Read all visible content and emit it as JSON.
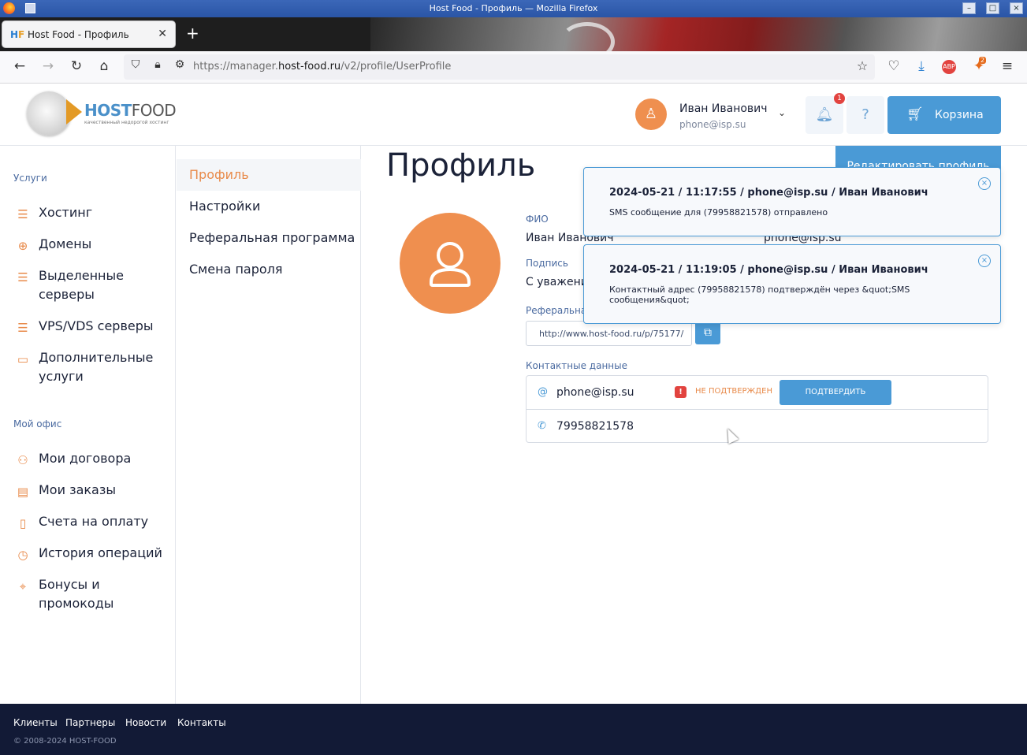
{
  "window": {
    "title": "Host Food - Профиль — Mozilla Firefox"
  },
  "browser": {
    "tab_title": "Host Food - Профиль",
    "url_prefix": "https://manager.",
    "url_domain": "host-food.ru",
    "url_path": "/v2/profile/UserProfile",
    "extension_badge": "2",
    "abp_label": "ABP"
  },
  "header": {
    "logo_host": "HOST",
    "logo_food": "FOOD",
    "logo_tagline": "качественный недорогой хостинг",
    "user_name": "Иван Иванович",
    "user_email": "phone@isp.su",
    "notifications_count": "1",
    "cart_label": "Корзина"
  },
  "sidebar": {
    "services_title": "Услуги",
    "services": [
      {
        "label": "Хостинг",
        "icon": "stack-icon"
      },
      {
        "label": "Домены",
        "icon": "globe-icon"
      },
      {
        "label": "Выделенные серверы",
        "icon": "server-icon"
      },
      {
        "label": "VPS/VDS серверы",
        "icon": "vps-icon"
      },
      {
        "label": "Дополнительные услуги",
        "icon": "window-icon"
      }
    ],
    "office_title": "Мой офис",
    "office": [
      {
        "label": "Мои договора",
        "icon": "users-icon"
      },
      {
        "label": "Мои заказы",
        "icon": "orders-icon"
      },
      {
        "label": "Счета на оплату",
        "icon": "invoice-icon"
      },
      {
        "label": "История операций",
        "icon": "history-icon"
      },
      {
        "label": "Бонусы и промокоды",
        "icon": "tag-icon"
      }
    ]
  },
  "submenu": {
    "items": [
      "Профиль",
      "Настройки",
      "Реферальная программа",
      "Смена пароля"
    ],
    "active_index": 0
  },
  "profile": {
    "title": "Профиль",
    "edit_button": "Редактировать профиль",
    "fio_label": "ФИО",
    "fio_value": "Иван Иванович",
    "email_value": "phone@isp.su",
    "signature_label": "Подпись",
    "signature_value": "С уважени",
    "referral_label": "Реферальна",
    "referral_link": "http://www.host-food.ru/p/75177/",
    "contacts_label": "Контактные данные",
    "contact_email": "phone@isp.su",
    "not_confirmed": "НЕ ПОДТВЕРЖДЕН",
    "confirm_button": "ПОДТВЕРДИТЬ",
    "contact_phone": "79958821578"
  },
  "toasts": [
    {
      "header": "2024-05-21 / 11:17:55 / phone@isp.su / Иван Иванович",
      "message": "SMS сообщение для (79958821578) отправлено"
    },
    {
      "header": "2024-05-21 / 11:19:05 / phone@isp.su / Иван Иванович",
      "message": "Контактный адрес (79958821578) подтверждён через &quot;SMS сообщения&quot;"
    }
  ],
  "footer": {
    "links": [
      "Клиенты",
      "Партнеры",
      "Новости",
      "Контакты"
    ],
    "copyright": "© 2008-2024 HOST-FOOD"
  },
  "colors": {
    "accent": "#4a9ad6",
    "orange": "#ef8f4f",
    "footer": "#121a36"
  }
}
